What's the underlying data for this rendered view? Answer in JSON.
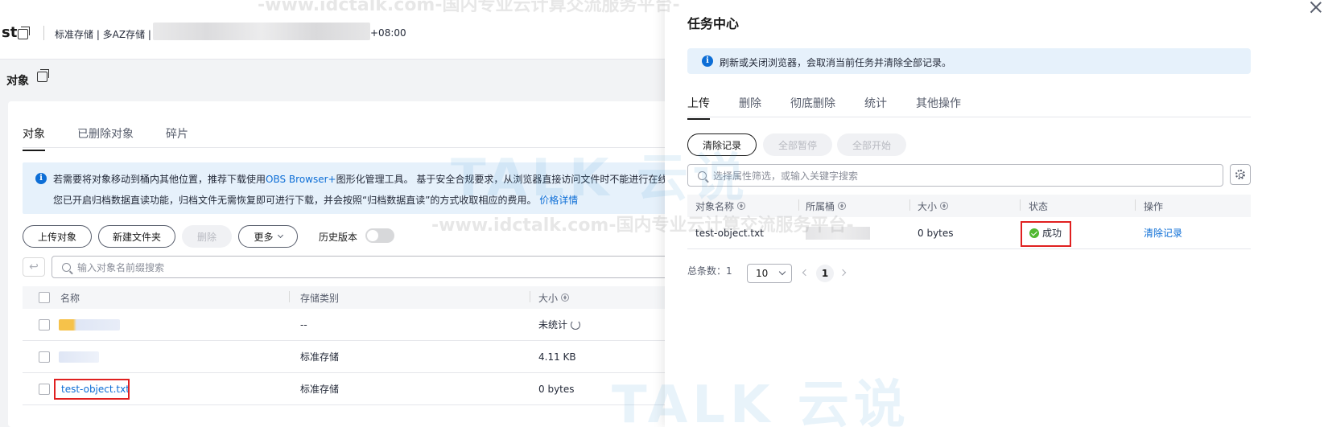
{
  "bucket": {
    "name_fragment": "st",
    "meta": "标准存储 | 多AZ存储 |",
    "timezone": "+08:00"
  },
  "section_title": "对象",
  "tabs": [
    "对象",
    "已删除对象",
    "碎片"
  ],
  "banner": {
    "line1_prefix": "若需要将对象移动到桶内其他位置，推荐下载使用",
    "line1_link": "OBS Browser+",
    "line1_suffix": "图形化管理工具。 基于安全合规要求，从浏览器直接访问文件时不能进行在线预览；若",
    "line2_text": "您已开启归档数据直读功能，归档文件无需恢复即可进行下载，并会按照“归档数据直读”的方式收取相应的费用。",
    "line2_link": "价格详情"
  },
  "toolbar": {
    "upload": "上传对象",
    "new_folder": "新建文件夹",
    "delete": "删除",
    "more": "更多",
    "history_versions": "历史版本",
    "history_versions_on": false
  },
  "search": {
    "placeholder": "输入对象名前缀搜索"
  },
  "table": {
    "headers": {
      "name": "名称",
      "storage": "存储类别",
      "size": "大小"
    },
    "rows": [
      {
        "name": "",
        "storage": "--",
        "size": "未统计"
      },
      {
        "name": "",
        "storage": "标准存储",
        "size": "4.11 KB"
      },
      {
        "name": "test-object.txt",
        "storage": "标准存储",
        "size": "0 bytes"
      }
    ]
  },
  "drawer": {
    "title": "任务中心",
    "notice": "刷新或关闭浏览器，会取消当前任务并清除全部记录。",
    "tabs": [
      "上传",
      "删除",
      "彻底删除",
      "统计",
      "其他操作"
    ],
    "buttons": {
      "clear": "清除记录",
      "pause_all": "全部暂停",
      "start_all": "全部开始"
    },
    "search_placeholder": "选择属性筛选，或输入关键字搜索",
    "headers": {
      "object_name": "对象名称",
      "bucket": "所属桶",
      "size": "大小",
      "status": "状态",
      "action": "操作"
    },
    "rows": [
      {
        "object_name": "test-object.txt",
        "bucket": "",
        "size": "0 bytes",
        "status": "成功",
        "action": "清除记录"
      }
    ],
    "total_label": "总条数：1",
    "page_size": "10",
    "current_page": "1"
  },
  "watermark": {
    "text": "-www.idctalk.com-国内专业云计算交流服务平台-",
    "logo": "TALK 云说"
  },
  "colors": {
    "accent": "#0d6ed6",
    "success": "#50b830",
    "highlight": "#e02020"
  }
}
